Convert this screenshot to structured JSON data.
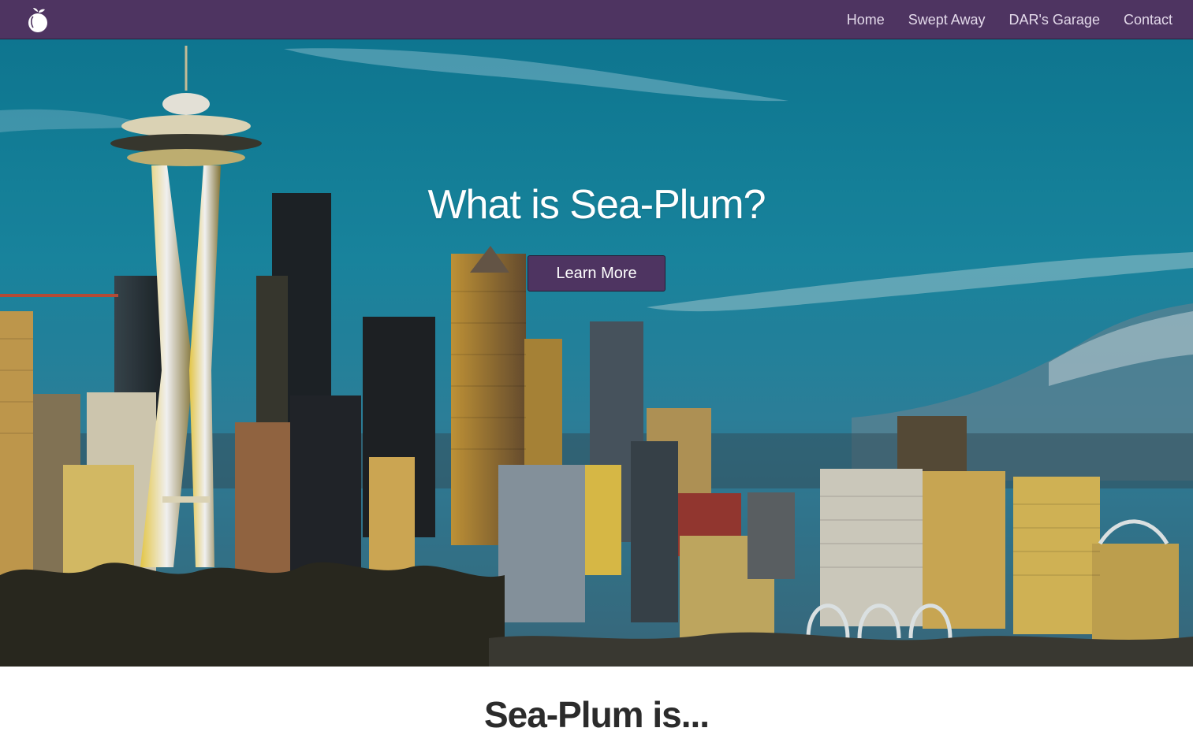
{
  "nav": {
    "logo_icon": "plum-fruit-icon",
    "links": [
      "Home",
      "Swept Away",
      "DAR's Garage",
      "Contact"
    ]
  },
  "hero": {
    "title": "What is Sea-Plum?",
    "button_label": "Learn More",
    "background": "seattle-skyline-with-space-needle"
  },
  "section": {
    "heading": "Sea-Plum is..."
  },
  "colors": {
    "brand_purple": "#4e3461",
    "nav_text": "#e3d9ea",
    "sky": "#1b8fa8"
  }
}
